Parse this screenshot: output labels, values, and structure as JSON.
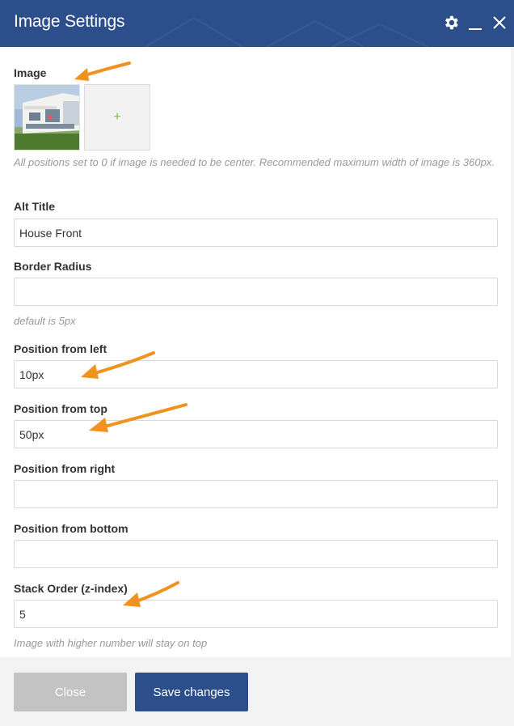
{
  "header": {
    "title": "Image Settings",
    "icons": [
      "gear-icon",
      "minimize-icon",
      "close-icon"
    ]
  },
  "image_section": {
    "label": "Image",
    "add_symbol": "+",
    "hint": "All positions set to 0 if image is needed to be center. Recommended maximum width of image is 360px."
  },
  "fields": {
    "alt_title": {
      "label": "Alt Title",
      "value": "House Front",
      "placeholder": ""
    },
    "border_radius": {
      "label": "Border Radius",
      "value": "",
      "placeholder": "",
      "hint": "default is 5px"
    },
    "position_left": {
      "label": "Position from left",
      "value": "10px",
      "placeholder": ""
    },
    "position_top": {
      "label": "Position from top",
      "value": "50px",
      "placeholder": ""
    },
    "position_right": {
      "label": "Position from right",
      "value": "",
      "placeholder": ""
    },
    "position_bottom": {
      "label": "Position from bottom",
      "value": "",
      "placeholder": ""
    },
    "z_index": {
      "label": "Stack Order (z-index)",
      "value": "5",
      "placeholder": "",
      "hint": "Image with higher number will stay on top"
    }
  },
  "footer": {
    "close_label": "Close",
    "save_label": "Save changes"
  },
  "colors": {
    "header_bg": "#2c4e8a",
    "save_button_bg": "#2c4e8a",
    "close_button_bg": "#c3c3c3",
    "annotation_arrow": "#f0931e",
    "add_plus": "#7cc04b"
  }
}
